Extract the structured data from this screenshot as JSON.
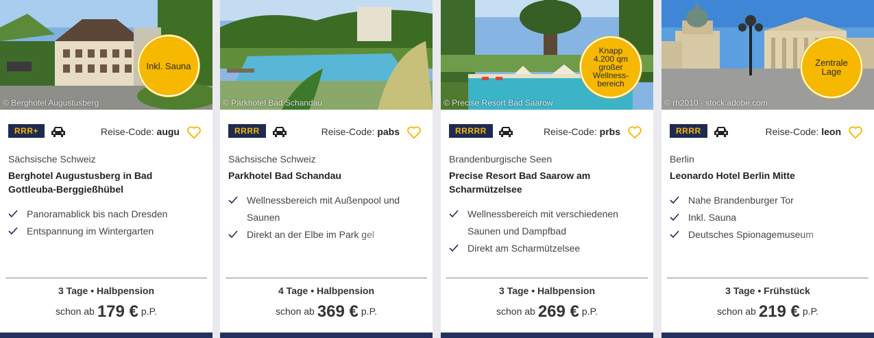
{
  "colors": {
    "navy": "#1e2a52",
    "badge": "#f6b800",
    "heart": "#f6b800"
  },
  "cards": [
    {
      "credit": "© Berghotel Augustusberg",
      "badge": "Inkl. Sauna",
      "stars": "RRR+",
      "code_label": "Reise-Code:",
      "code": "augu",
      "region": "Sächsische Schweiz",
      "name": "Berghotel Augustusberg in Bad Gottleuba-Berggießhübel",
      "features": [
        "Panoramablick bis nach Dresden",
        "Entspannung im Wintergarten"
      ],
      "duration": "3 Tage • Halbpension",
      "price_prefix": "schon ab",
      "price": "179 €",
      "price_suffix": "p.P."
    },
    {
      "credit": "© Parkhotel Bad Schandau",
      "badge": "",
      "stars": "RRRR",
      "code_label": "Reise-Code:",
      "code": "pabs",
      "region": "Sächsische Schweiz",
      "name": "Parkhotel Bad Schandau",
      "features": [
        "Wellnessbereich mit Außenpool und Saunen",
        "Direkt an der Elbe im Park gel"
      ],
      "duration": "4 Tage • Halbpension",
      "price_prefix": "schon ab",
      "price": "369 €",
      "price_suffix": "p.P."
    },
    {
      "credit": "© Precise Resort Bad Saarow",
      "badge": "Knapp 4.200 qm großer Wellness-bereich",
      "stars": "RRRRR",
      "code_label": "Reise-Code:",
      "code": "prbs",
      "region": "Brandenburgische Seen",
      "name": "Precise Resort Bad Saarow am Scharmützelsee",
      "features": [
        "Wellnessbereich mit verschiedenen Saunen und Dampfbad",
        "Direkt am Scharmützelsee"
      ],
      "duration": "3 Tage • Halbpension",
      "price_prefix": "schon ab",
      "price": "269 €",
      "price_suffix": "p.P."
    },
    {
      "credit": "© rh2010 - stock.adobe.com",
      "badge": "Zentrale Lage",
      "stars": "RRRR",
      "code_label": "Reise-Code:",
      "code": "leon",
      "region": "Berlin",
      "name": "Leonardo Hotel Berlin Mitte",
      "features": [
        "Nahe Brandenburger Tor",
        "Inkl. Sauna",
        "Deutsches Spionagemuseum"
      ],
      "duration": "3 Tage • Frühstück",
      "price_prefix": "schon ab",
      "price": "219 €",
      "price_suffix": "p.P."
    }
  ]
}
